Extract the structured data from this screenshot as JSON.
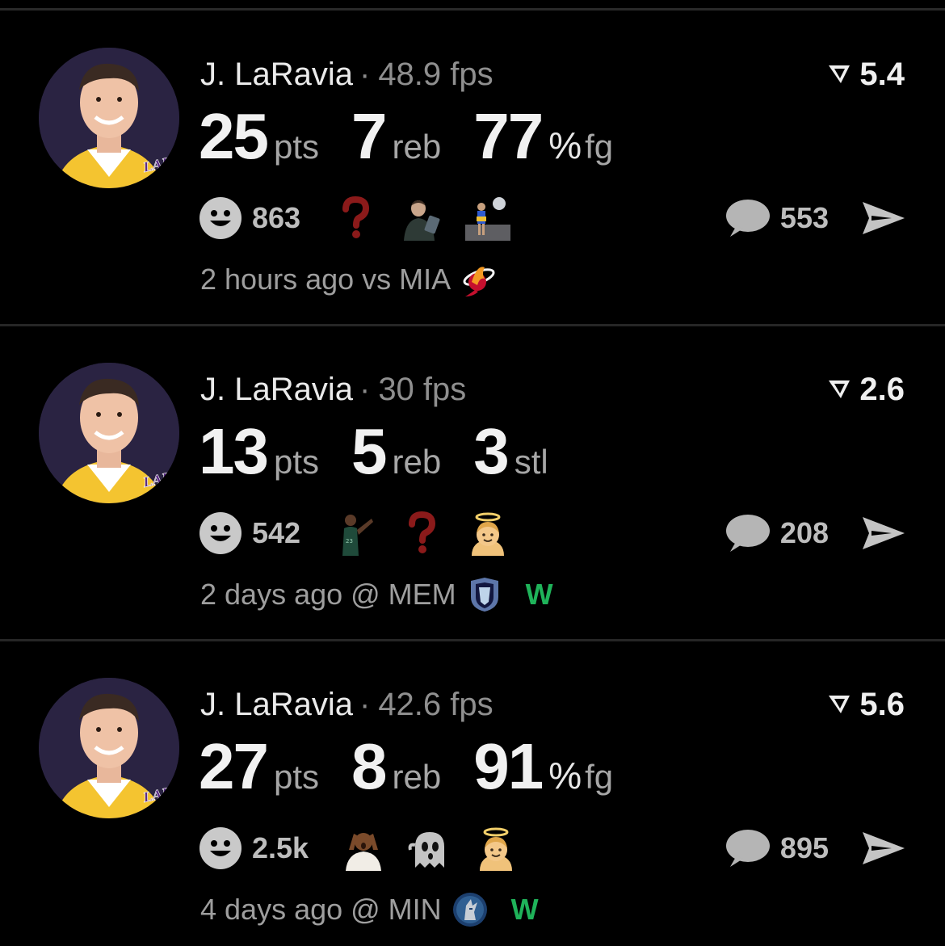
{
  "colors": {
    "background": "#000000",
    "win": "#1fb35a",
    "question_mark": "#8b1a1a",
    "muted_text": "#9e9e9e"
  },
  "posts": [
    {
      "player": "J. LaRavia",
      "separator": "·",
      "fps": "48.9 fps",
      "score": "5.4",
      "stats": [
        {
          "value": "25",
          "unit": "pts",
          "pct": ""
        },
        {
          "value": "7",
          "unit": "reb",
          "pct": ""
        },
        {
          "value": "77",
          "unit": "fg",
          "pct": "%"
        }
      ],
      "reaction_count": "863",
      "reactions": [
        "question-mark-icon",
        "man-on-phone-sticker",
        "player-moon-sticker"
      ],
      "comment_count": "553",
      "time": "2 hours ago vs MIA",
      "opponent_logo": "heat-logo-icon",
      "result": ""
    },
    {
      "player": "J. LaRavia",
      "separator": "·",
      "fps": "30 fps",
      "score": "2.6",
      "stats": [
        {
          "value": "13",
          "unit": "pts",
          "pct": ""
        },
        {
          "value": "5",
          "unit": "reb",
          "pct": ""
        },
        {
          "value": "3",
          "unit": "stl",
          "pct": ""
        }
      ],
      "reaction_count": "542",
      "reactions": [
        "player-celebration-sticker",
        "question-mark-icon",
        "angel-face-icon"
      ],
      "comment_count": "208",
      "time": "2 days ago @ MEM",
      "opponent_logo": "grizzlies-logo-icon",
      "result": "W"
    },
    {
      "player": "J. LaRavia",
      "separator": "·",
      "fps": "42.6 fps",
      "score": "5.6",
      "stats": [
        {
          "value": "27",
          "unit": "pts",
          "pct": ""
        },
        {
          "value": "8",
          "unit": "reb",
          "pct": ""
        },
        {
          "value": "91",
          "unit": "fg",
          "pct": "%"
        }
      ],
      "reaction_count": "2.5k",
      "reactions": [
        "shocked-man-sticker",
        "ghost-icon",
        "angel-face-icon"
      ],
      "comment_count": "895",
      "time": "4 days ago @ MIN",
      "opponent_logo": "timberwolves-logo-icon",
      "result": "W"
    }
  ]
}
